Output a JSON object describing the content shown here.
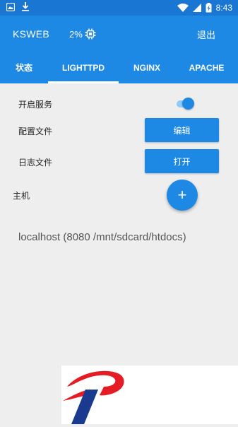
{
  "status_bar": {
    "time": "8:43",
    "icons_left": [
      "notification-image-icon",
      "download-icon"
    ],
    "icons_right": [
      "wifi-icon",
      "signal-icon",
      "battery-charging-icon"
    ]
  },
  "app_bar": {
    "title": "KSWEB",
    "cpu_usage": "2%",
    "exit_label": "退出"
  },
  "tabs": [
    {
      "label": "状态",
      "active": false
    },
    {
      "label": "LIGHTTPD",
      "active": true
    },
    {
      "label": "NGINX",
      "active": false
    },
    {
      "label": "APACHE",
      "active": false
    }
  ],
  "settings": {
    "enable_service_label": "开启服务",
    "enable_service_on": true,
    "config_file_label": "配置文件",
    "edit_button": "编辑",
    "log_file_label": "日志文件",
    "open_button": "打开",
    "host_label": "主机",
    "add_icon": "+",
    "host_entry": "localhost (8080 /mnt/sdcard/htdocs)"
  },
  "colors": {
    "primary": "#1e88e5",
    "primary_dark": "#1976d2",
    "background": "#eeeeee"
  }
}
